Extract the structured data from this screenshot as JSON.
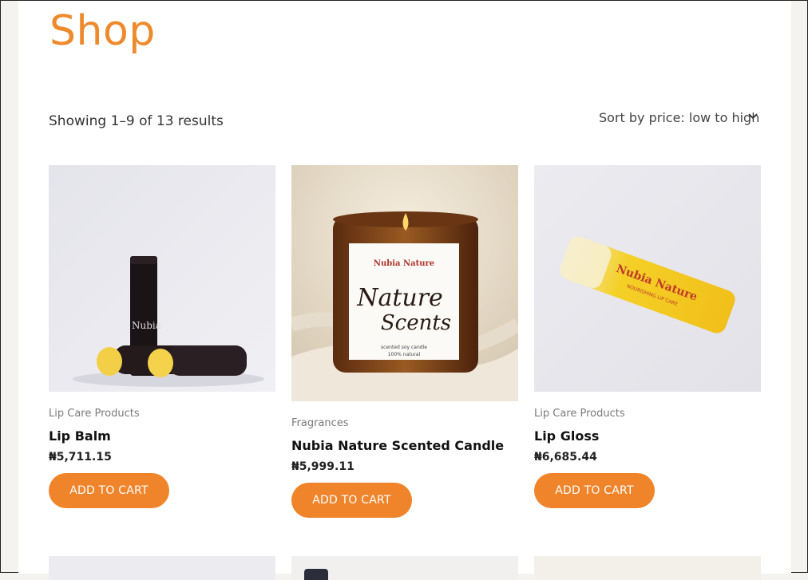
{
  "page": {
    "title": "Shop"
  },
  "toolbar": {
    "result_count": "Showing 1–9 of 13 results",
    "sort_selected": "Sort by price: low to high"
  },
  "products": [
    {
      "category": "Lip Care Products",
      "name": "Lip Balm",
      "price": "₦5,711.15",
      "button": "ADD TO CART"
    },
    {
      "category": "Fragrances",
      "name": "Nubia Nature Scented Candle",
      "price": "₦5,999.11",
      "button": "ADD TO CART",
      "image_text": {
        "brand": "Nubia Nature",
        "script1": "Nature",
        "script2": "Scents",
        "line1": "scented soy candle",
        "line2": "100% natural"
      }
    },
    {
      "category": "Lip Care Products",
      "name": "Lip Gloss",
      "price": "₦6,685.44",
      "button": "ADD TO CART",
      "image_text": {
        "brand": "Nubia Nature",
        "sub": "NOURISHING LIP CARE"
      }
    }
  ],
  "colors": {
    "accent": "#ef842b",
    "title": "#ef8a2c"
  }
}
